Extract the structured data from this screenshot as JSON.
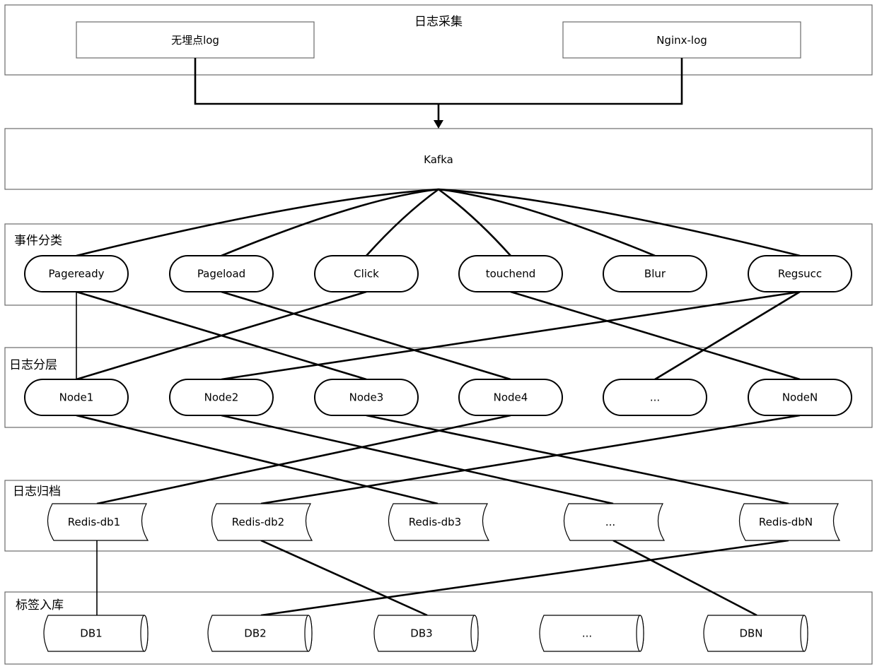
{
  "diagram": {
    "collection": {
      "title": "日志采集",
      "sources": [
        "无埋点log",
        "Nginx-log"
      ]
    },
    "queue": {
      "label": "Kafka"
    },
    "events": {
      "title": "事件分类",
      "items": [
        "Pageready",
        "Pageload",
        "Click",
        "touchend",
        "Blur",
        "Regsucc"
      ]
    },
    "nodes": {
      "title": "日志分层",
      "items": [
        "Node1",
        "Node2",
        "Node3",
        "Node4",
        "...",
        "NodeN"
      ]
    },
    "redis": {
      "title": "日志归档",
      "items": [
        "Redis-db1",
        "Redis-db2",
        "Redis-db3",
        "...",
        "Redis-dbN"
      ]
    },
    "databases": {
      "title": "标签入库",
      "items": [
        "DB1",
        "DB2",
        "DB3",
        "...",
        "DBN"
      ]
    },
    "edges": {
      "sources_to_queue": [
        0,
        1
      ],
      "queue_to_events": [
        0,
        1,
        2,
        3,
        4,
        5
      ],
      "events_to_nodes": [
        [
          0,
          0
        ],
        [
          0,
          2
        ],
        [
          1,
          3
        ],
        [
          2,
          0
        ],
        [
          3,
          5
        ],
        [
          5,
          1
        ],
        [
          5,
          4
        ]
      ],
      "nodes_to_redis": [
        [
          0,
          2
        ],
        [
          1,
          3
        ],
        [
          2,
          4
        ],
        [
          3,
          0
        ],
        [
          5,
          1
        ]
      ],
      "redis_to_databases": [
        [
          0,
          0
        ],
        [
          1,
          2
        ],
        [
          3,
          4
        ],
        [
          4,
          1
        ]
      ]
    },
    "colors": {
      "line": "#000000",
      "frame": "#6b6b6b",
      "background": "#ffffff"
    }
  }
}
